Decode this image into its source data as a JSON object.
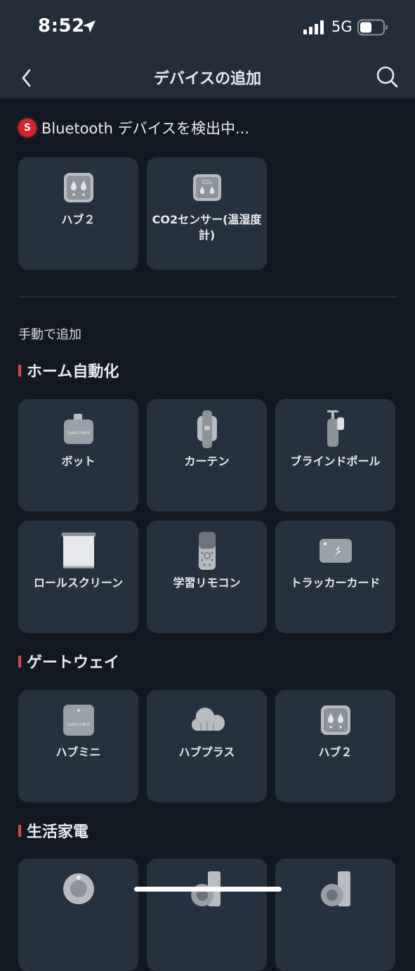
{
  "status": {
    "time": "8:52",
    "network": "5G"
  },
  "nav": {
    "title": "デバイスの追加"
  },
  "scan": {
    "badge": "S",
    "text": "Bluetooth デバイスを検出中..."
  },
  "detected": [
    {
      "label": "ハブ２",
      "icon": "hub2-icon"
    },
    {
      "label": "CO2センサー(温湿度計)",
      "icon": "co2-sensor-icon",
      "icon_text": "CO₂"
    }
  ],
  "manual_label": "手動で追加",
  "sections": {
    "home_automation": {
      "title": "ホーム自動化",
      "items": [
        {
          "label": "ボット",
          "icon": "bot-icon",
          "icon_text": "SwitchBot"
        },
        {
          "label": "カーテン",
          "icon": "curtain-icon"
        },
        {
          "label": "ブラインドポール",
          "icon": "blind-tilt-icon"
        },
        {
          "label": "ロールスクリーン",
          "icon": "roller-shade-icon"
        },
        {
          "label": "学習リモコン",
          "icon": "remote-icon"
        },
        {
          "label": "トラッカーカード",
          "icon": "tracker-card-icon"
        }
      ]
    },
    "gateway": {
      "title": "ゲートウェイ",
      "items": [
        {
          "label": "ハブミニ",
          "icon": "hub-mini-icon",
          "icon_text": "SwitchBot"
        },
        {
          "label": "ハブプラス",
          "icon": "hub-plus-icon"
        },
        {
          "label": "ハブ２",
          "icon": "hub2-icon"
        }
      ]
    },
    "appliances": {
      "title": "生活家電",
      "items": [
        {
          "icon": "robot-vacuum-icon"
        },
        {
          "icon": "robot-vacuum-dock-icon"
        },
        {
          "icon": "robot-vacuum-station-icon"
        }
      ]
    }
  }
}
